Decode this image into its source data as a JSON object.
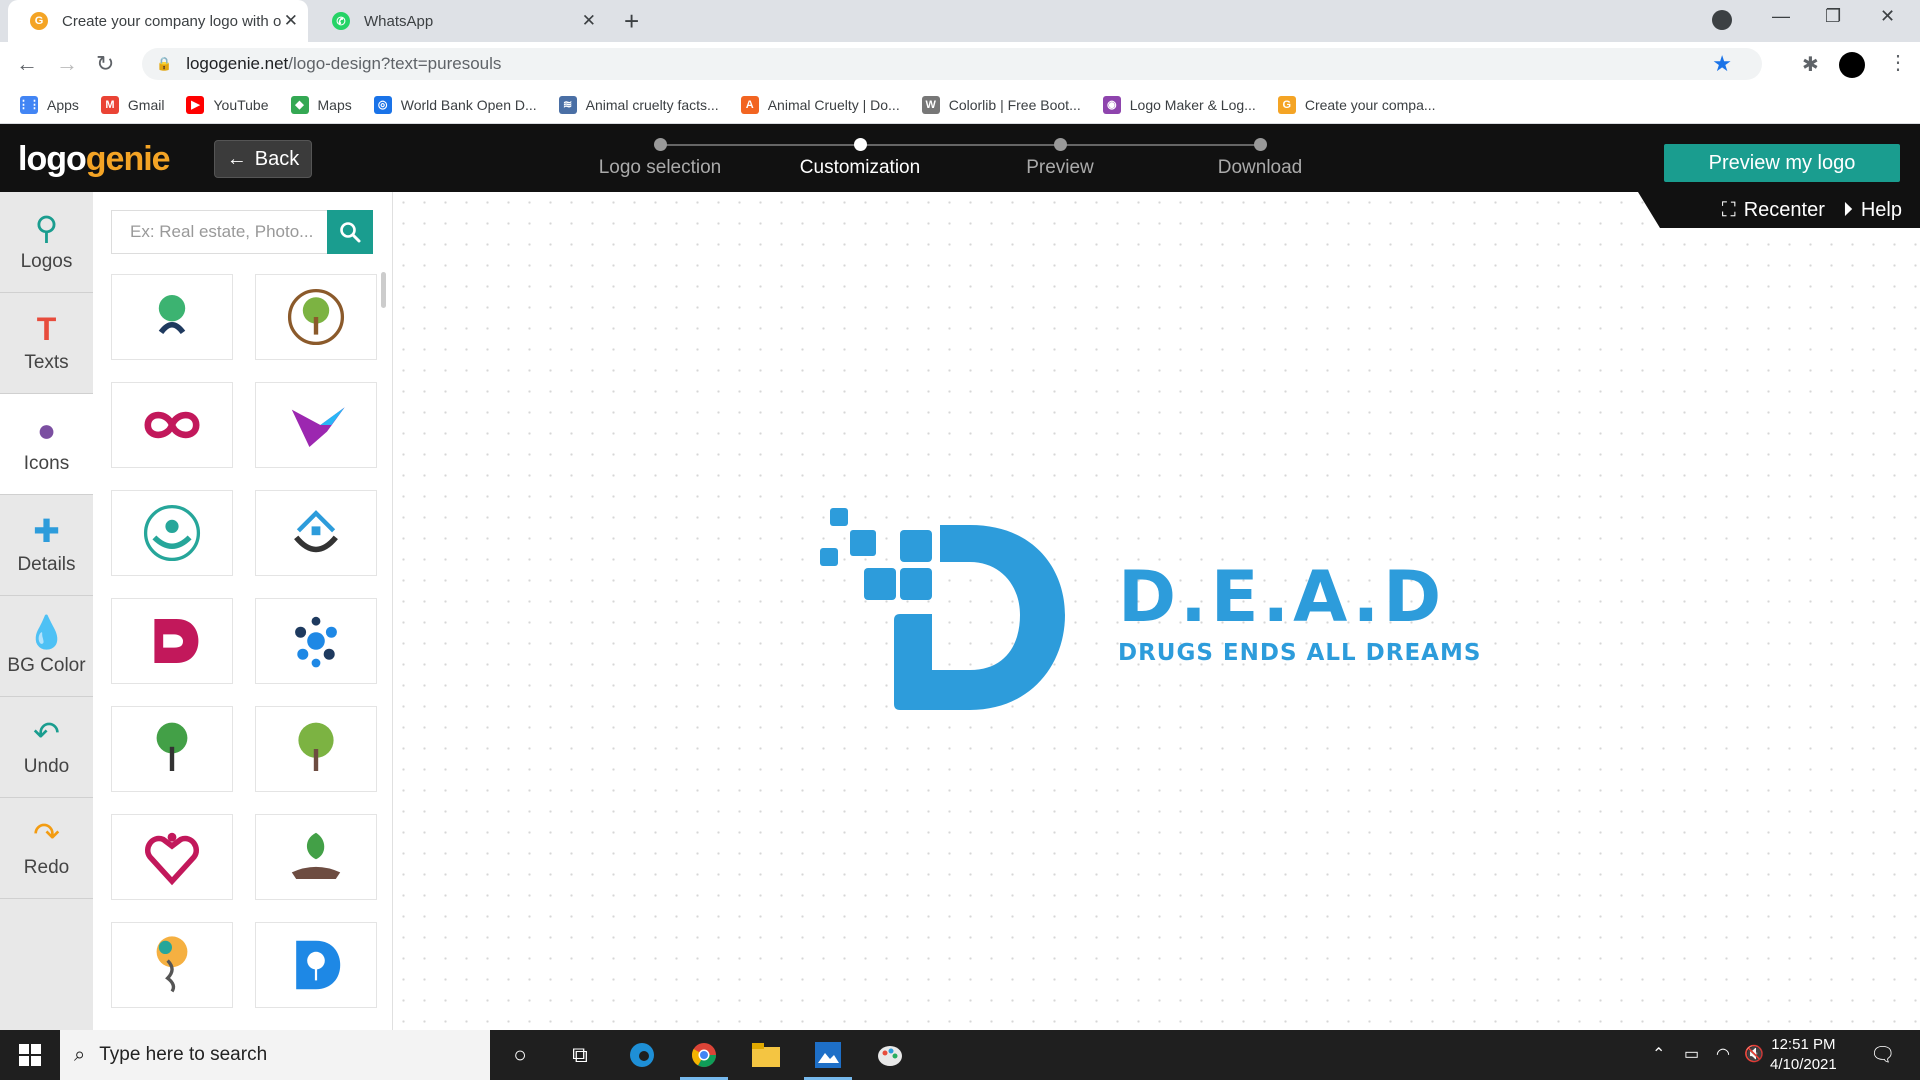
{
  "browser": {
    "tabs": [
      {
        "title": "Create your company logo with o",
        "active": true
      },
      {
        "title": "WhatsApp",
        "active": false
      }
    ],
    "url_domain": "logogenie.net",
    "url_path": "/logo-design?text=puresouls",
    "bookmarks": [
      {
        "label": "Apps",
        "icon": "apps-grid-icon",
        "color": "#4285f4"
      },
      {
        "label": "Gmail",
        "icon": "gmail-icon",
        "color": "#ea4335"
      },
      {
        "label": "YouTube",
        "icon": "youtube-icon",
        "color": "#ff0000"
      },
      {
        "label": "Maps",
        "icon": "maps-icon",
        "color": "#34a853"
      },
      {
        "label": "World Bank Open D...",
        "icon": "globe-icon",
        "color": "#1a73e8"
      },
      {
        "label": "Animal cruelty facts...",
        "icon": "site-icon",
        "color": "#4a6fa5"
      },
      {
        "label": "Animal Cruelty | Do...",
        "icon": "aspca-icon",
        "color": "#f26522"
      },
      {
        "label": "Colorlib | Free Boot...",
        "icon": "wordpress-icon",
        "color": "#777777"
      },
      {
        "label": "Logo Maker & Log...",
        "icon": "logo-maker-icon",
        "color": "#8e44ad"
      },
      {
        "label": "Create your compa...",
        "icon": "logogenie-icon",
        "color": "#f4a425"
      }
    ]
  },
  "app": {
    "brand_part1": "logo",
    "brand_part2": "genie",
    "back_label": "Back",
    "steps": [
      {
        "label": "Logo selection",
        "active": false
      },
      {
        "label": "Customization",
        "active": true
      },
      {
        "label": "Preview",
        "active": false
      },
      {
        "label": "Download",
        "active": false
      }
    ],
    "preview_label": "Preview my logo",
    "sidebar": [
      {
        "label": "Logos",
        "icon": "search-icon",
        "color": "#1a9d8f"
      },
      {
        "label": "Texts",
        "icon": "text-t-icon",
        "color": "#e74c3c"
      },
      {
        "label": "Icons",
        "icon": "icons-blob-icon",
        "color": "#7b4fa1"
      },
      {
        "label": "Details",
        "icon": "plus-icon",
        "color": "#2d9cdb"
      },
      {
        "label": "BG Color",
        "icon": "drop-icon",
        "color": "#27ae60"
      },
      {
        "label": "Undo",
        "icon": "undo-icon",
        "color": "#1a9d8f"
      },
      {
        "label": "Redo",
        "icon": "redo-icon",
        "color": "#f39c12"
      }
    ],
    "search_placeholder": "Ex: Real estate, Photo...",
    "recenter_label": "Recenter",
    "help_label": "Help",
    "logo": {
      "title": "D.E.A.D",
      "subtitle": "DRUGS ENDS ALL DREAMS",
      "color": "#2d9cdb"
    },
    "thumbnails": [
      "tree-hand-icon",
      "tree-circle-icon",
      "infinity-icon",
      "hummingbird-icon",
      "tree-people-icon",
      "house-hands-icon",
      "letter-d-icon",
      "molecule-dots-icon",
      "green-tree-icon",
      "green-tree-2-icon",
      "heart-people-icon",
      "leaf-hand-icon",
      "dna-tree-icon",
      "d-tree-icon"
    ]
  },
  "taskbar": {
    "search_placeholder": "Type here to search",
    "time": "12:51 PM",
    "date": "4/10/2021"
  }
}
